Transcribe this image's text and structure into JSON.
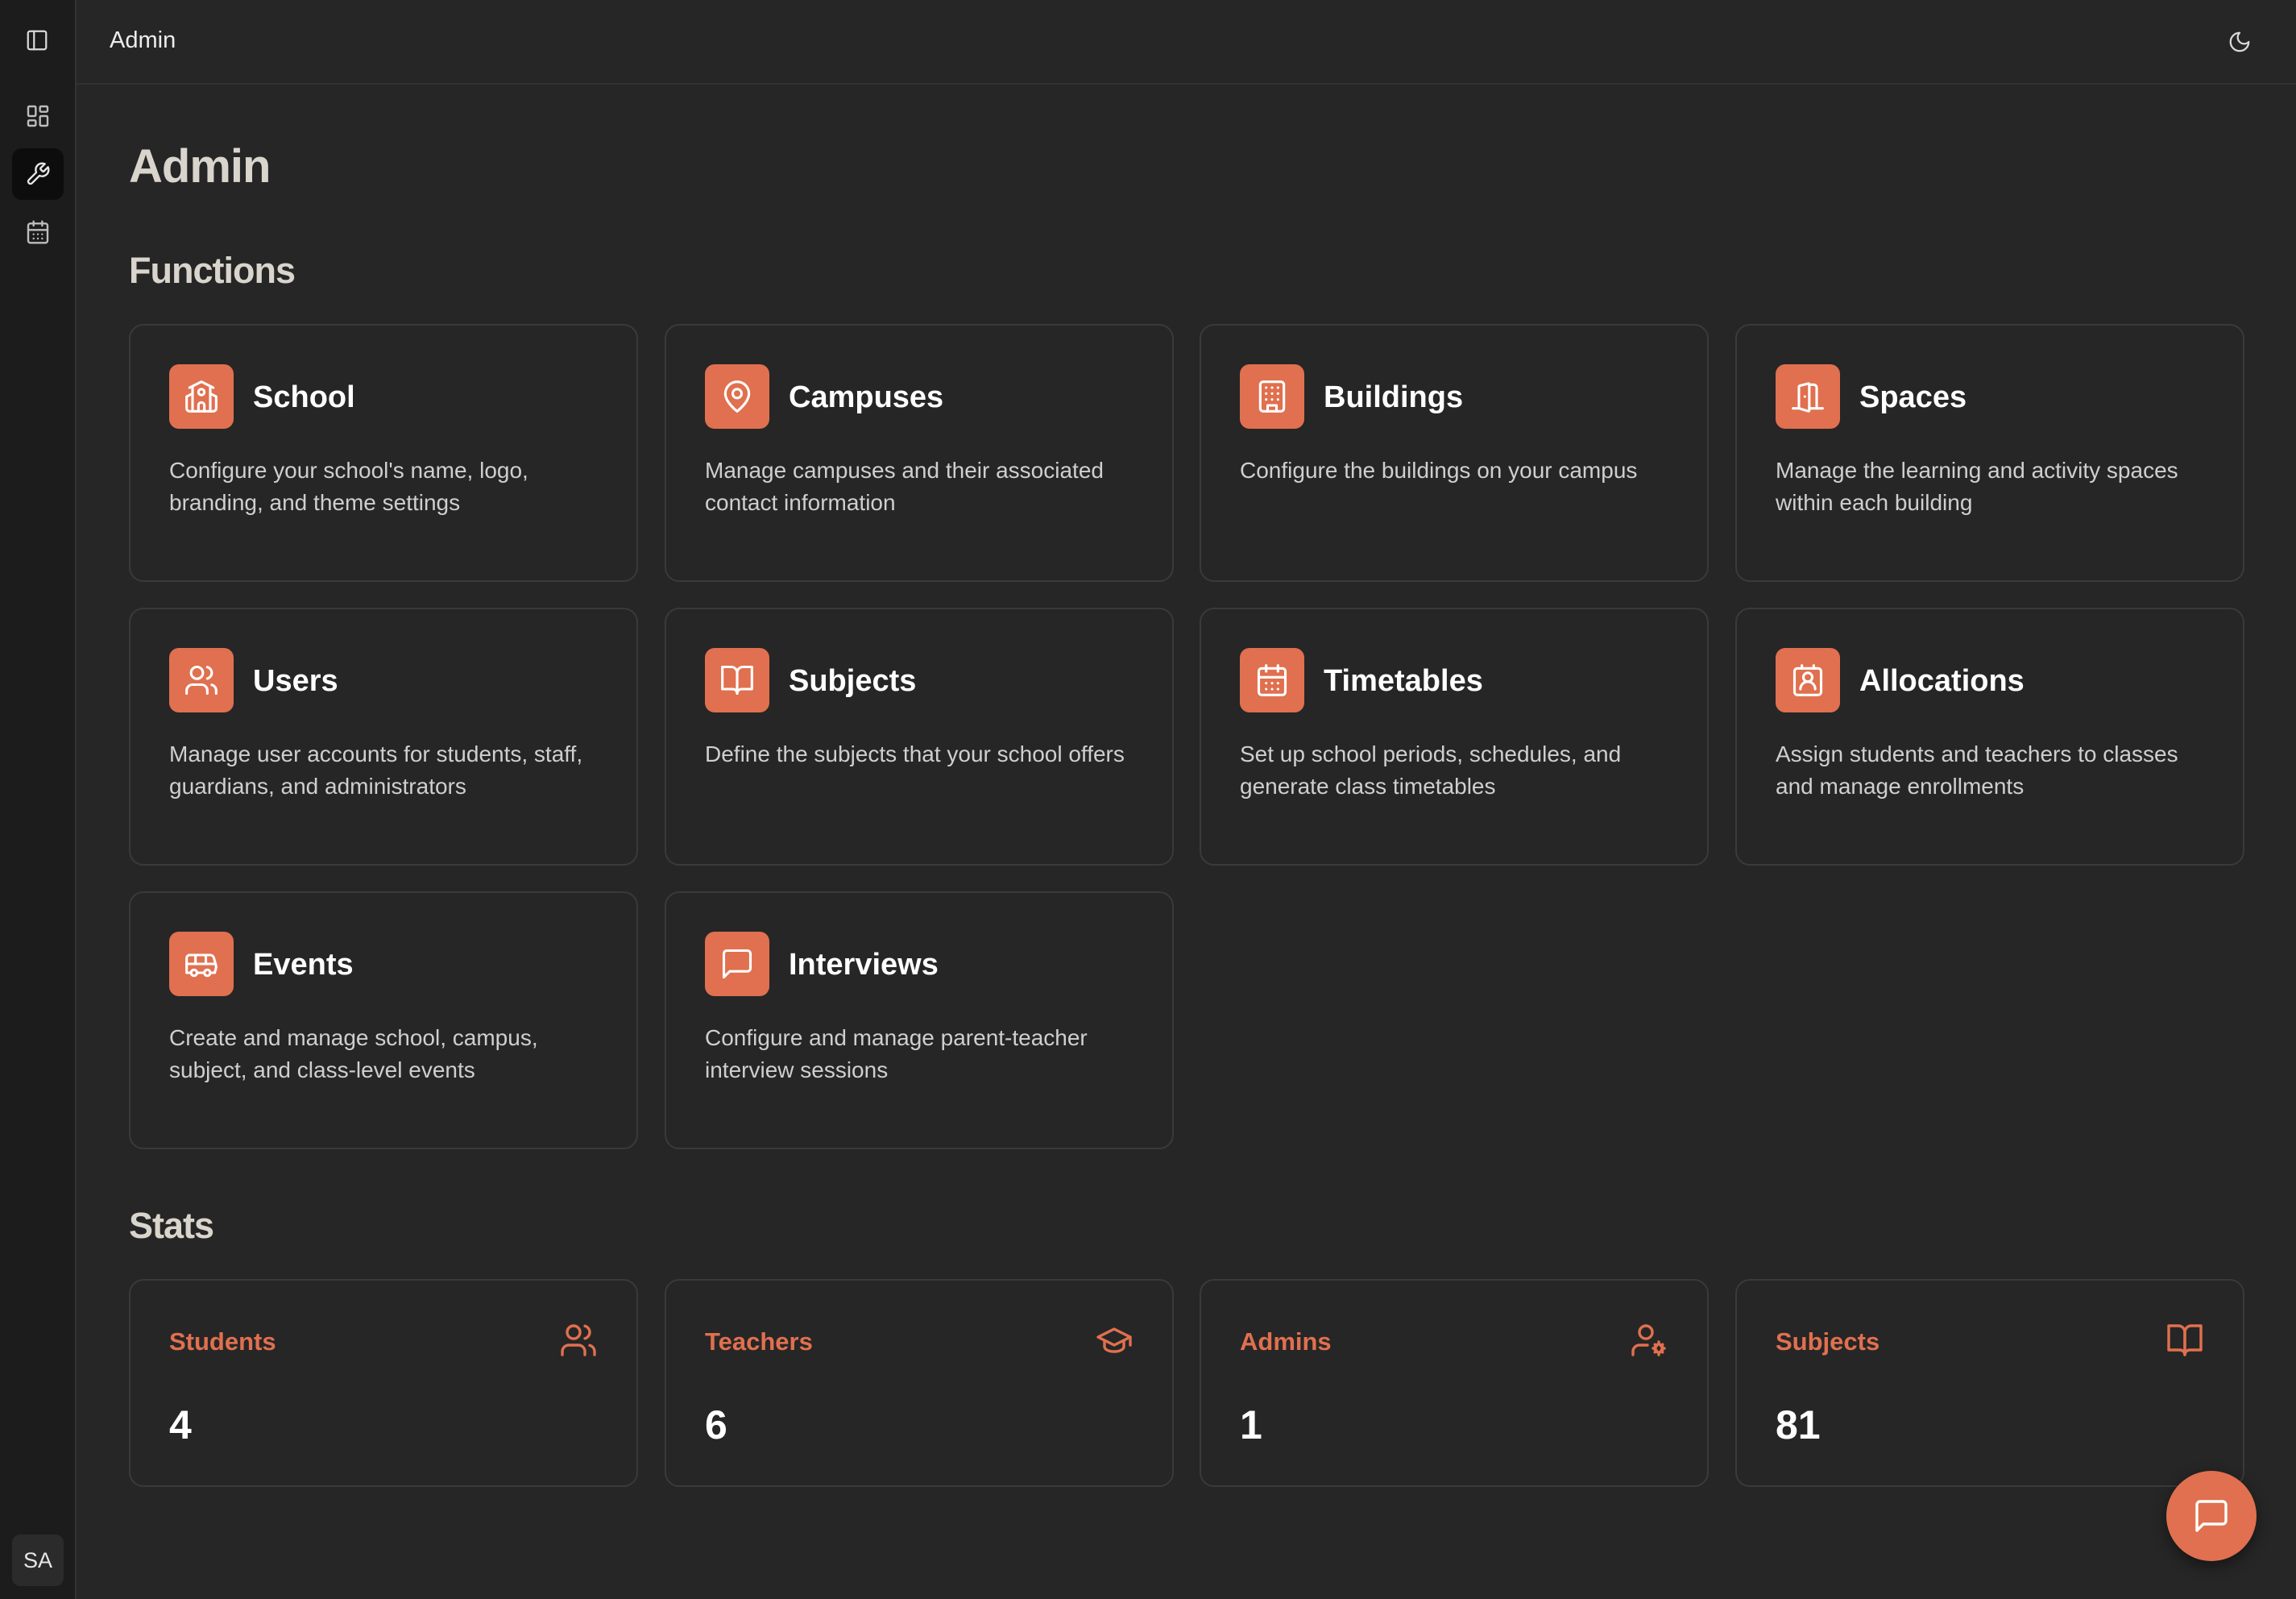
{
  "header": {
    "title": "Admin"
  },
  "sidebar": {
    "avatar_initials": "SA"
  },
  "page": {
    "title": "Admin"
  },
  "functions": {
    "title": "Functions",
    "cards": [
      {
        "title": "School",
        "description": "Configure your school's name, logo, branding, and theme settings",
        "icon": "school-icon"
      },
      {
        "title": "Campuses",
        "description": "Manage campuses and their associated contact information",
        "icon": "map-pin-icon"
      },
      {
        "title": "Buildings",
        "description": "Configure the buildings on your campus",
        "icon": "building-icon"
      },
      {
        "title": "Spaces",
        "description": "Manage the learning and activity spaces within each building",
        "icon": "door-icon"
      },
      {
        "title": "Users",
        "description": "Manage user accounts for students, staff, guardians, and administrators",
        "icon": "users-icon"
      },
      {
        "title": "Subjects",
        "description": "Define the subjects that your school offers",
        "icon": "book-open-icon"
      },
      {
        "title": "Timetables",
        "description": "Set up school periods, schedules, and generate class timetables",
        "icon": "calendar-icon"
      },
      {
        "title": "Allocations",
        "description": "Assign students and teachers to classes and manage enrollments",
        "icon": "contact-icon"
      },
      {
        "title": "Events",
        "description": "Create and manage school, campus, subject, and class-level events",
        "icon": "bus-icon"
      },
      {
        "title": "Interviews",
        "description": "Configure and manage parent-teacher interview sessions",
        "icon": "message-square-icon"
      }
    ]
  },
  "stats": {
    "title": "Stats",
    "items": [
      {
        "label": "Students",
        "value": "4",
        "icon": "users-icon"
      },
      {
        "label": "Teachers",
        "value": "6",
        "icon": "graduation-cap-icon"
      },
      {
        "label": "Admins",
        "value": "1",
        "icon": "user-cog-icon"
      },
      {
        "label": "Subjects",
        "value": "81",
        "icon": "book-open-icon"
      }
    ]
  },
  "colors": {
    "accent": "#e0704f",
    "background": "#262626",
    "sidebar": "#1c1c1c"
  }
}
